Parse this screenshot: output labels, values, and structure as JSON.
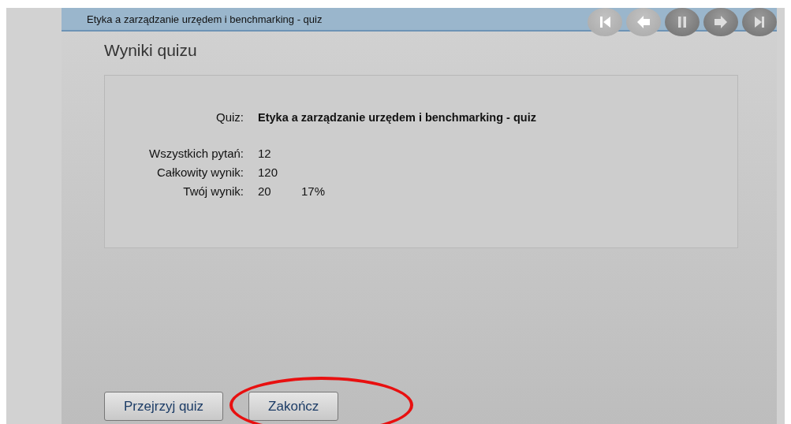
{
  "window": {
    "title": "Etyka a zarządzanie urzędem i benchmarking - quiz"
  },
  "nav_buttons": [
    {
      "kind": "first",
      "disabled": true
    },
    {
      "kind": "back",
      "disabled": true
    },
    {
      "kind": "pause",
      "disabled": false
    },
    {
      "kind": "next",
      "disabled": false
    },
    {
      "kind": "last",
      "disabled": false
    }
  ],
  "heading": "Wyniki quizu",
  "results": [
    {
      "label": "Quiz:",
      "value": "Etyka a zarządzanie urzędem i benchmarking - quiz"
    },
    {
      "label": "Wszystkich pytań:",
      "value": "12"
    },
    {
      "label": "Całkowity wynik:",
      "value": "120"
    },
    {
      "label": "Twój wynik:",
      "value": "20",
      "percent": "17%"
    }
  ],
  "buttons": [
    {
      "label": "Przejrzyj quiz",
      "circled": false
    },
    {
      "label": "Zakończ",
      "circled": true
    }
  ]
}
